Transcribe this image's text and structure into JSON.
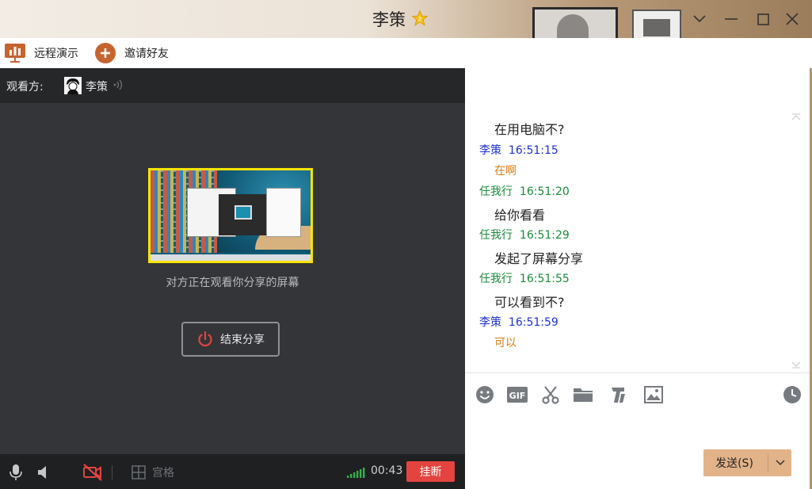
{
  "window": {
    "title": "李策",
    "controls": [
      "chevron-down-icon",
      "minimize-icon",
      "maximize-icon",
      "close-icon"
    ]
  },
  "toolbar": {
    "remote_demo": "远程演示",
    "invite_friends": "邀请好友"
  },
  "share": {
    "viewer_label": "观看方:",
    "viewer_name": "李策",
    "caption": "对方正在观看你分享的屏幕",
    "end_button": "结束分享"
  },
  "call_bar": {
    "grid_label": "宫格",
    "timer": "00:43",
    "hangup": "挂断"
  },
  "chat": {
    "messages": [
      {
        "body": "在用电脑不?"
      },
      {
        "sender": "李策",
        "time": "16:51:15",
        "sender_color": "#1c2fd6"
      },
      {
        "body": "在啊",
        "body_color": "#e07b12"
      },
      {
        "sender": "任我行",
        "time": "16:51:20",
        "sender_color": "#1a8a3a"
      },
      {
        "body": "给你看看"
      },
      {
        "sender": "任我行",
        "time": "16:51:29",
        "sender_color": "#1a8a3a"
      },
      {
        "body": "发起了屏幕分享"
      },
      {
        "sender": "任我行",
        "time": "16:51:55",
        "sender_color": "#1a8a3a"
      },
      {
        "body": "可以看到不?"
      },
      {
        "sender": "李策",
        "time": "16:51:59",
        "sender_color": "#1c2fd6"
      },
      {
        "body": "可以",
        "body_color": "#e07b12"
      }
    ]
  },
  "input_tools": [
    "emoji-icon",
    "gif-icon",
    "scissors-icon",
    "folder-icon",
    "font-icon",
    "image-icon",
    "history-clock-icon"
  ],
  "send": {
    "label": "发送(S)",
    "accent": "#e2b389"
  },
  "colors": {
    "hangup_red": "#e4443f",
    "highlight_yellow": "#f7e400",
    "signal_green": "#36b04a"
  }
}
